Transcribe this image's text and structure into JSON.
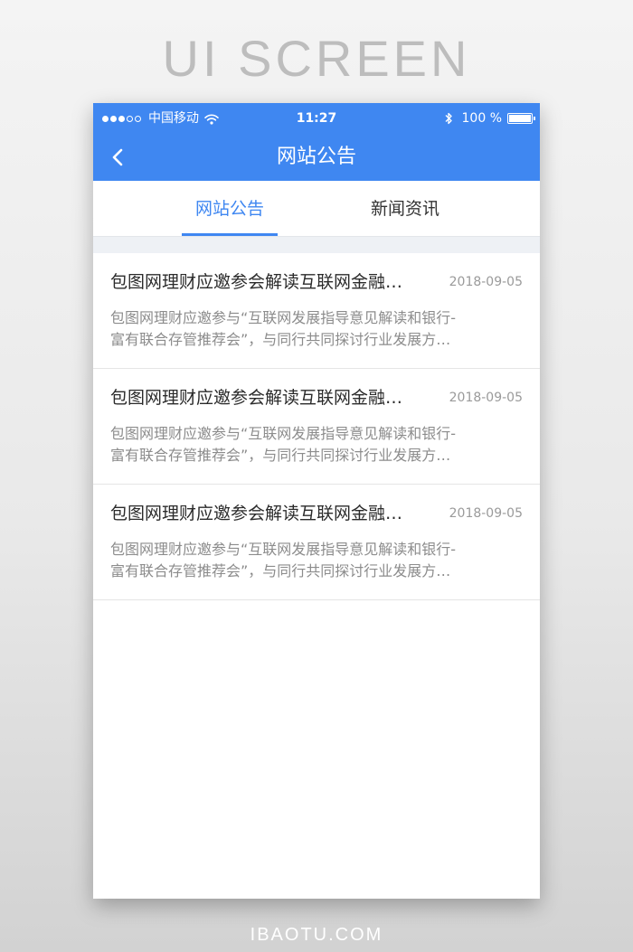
{
  "page": {
    "heading": "UI SCREEN",
    "footer": "IBAOTU.COM"
  },
  "status_bar": {
    "carrier": "中国移动",
    "time": "11:27",
    "battery": "100 %",
    "battery_level": 1.0,
    "signal_bars": 3,
    "signal_total": 5
  },
  "nav": {
    "title": "网站公告",
    "back_icon": "chevron-left-icon"
  },
  "tabs": [
    {
      "label": "网站公告",
      "active": true
    },
    {
      "label": "新闻资讯",
      "active": false
    }
  ],
  "news": [
    {
      "title": "包图网理财应邀参会解读互联网金融…",
      "date": "2018-09-05",
      "summary_line1": "包图网理财应邀参与“互联网发展指导意见解读和银行-",
      "summary_line2": "富有联合存管推荐会”，与同行共同探讨行业发展方…"
    },
    {
      "title": "包图网理财应邀参会解读互联网金融…",
      "date": "2018-09-05",
      "summary_line1": "包图网理财应邀参与“互联网发展指导意见解读和银行-",
      "summary_line2": "富有联合存管推荐会”，与同行共同探讨行业发展方…"
    },
    {
      "title": "包图网理财应邀参会解读互联网金融…",
      "date": "2018-09-05",
      "summary_line1": "包图网理财应邀参与“互联网发展指导意见解读和银行-",
      "summary_line2": "富有联合存管推荐会”，与同行共同探讨行业发展方…"
    }
  ],
  "colors": {
    "primary": "#3f87f1",
    "title_text": "#2b2b2b",
    "summary_text": "#8c8c8c",
    "date_text": "#9a9a9a"
  }
}
